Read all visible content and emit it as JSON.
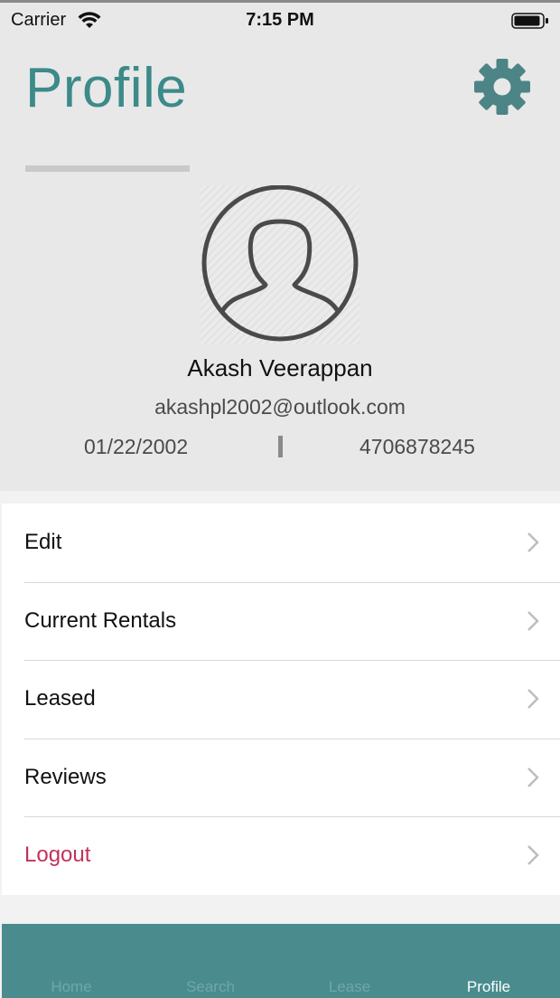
{
  "status_bar": {
    "carrier": "Carrier",
    "time": "7:15 PM"
  },
  "header": {
    "title": "Profile"
  },
  "user": {
    "name": "Akash Veerappan",
    "email": "akashpl2002@outlook.com",
    "dob": "01/22/2002",
    "phone": "4706878245"
  },
  "menu": {
    "items": [
      {
        "label": "Edit"
      },
      {
        "label": "Current Rentals"
      },
      {
        "label": "Leased"
      },
      {
        "label": "Reviews"
      },
      {
        "label": "Logout"
      }
    ]
  },
  "tabs": [
    {
      "label": "Home"
    },
    {
      "label": "Search"
    },
    {
      "label": "Lease"
    },
    {
      "label": "Profile"
    }
  ],
  "colors": {
    "accent": "#3c8a8a",
    "tab_bar": "#4a8c8e",
    "logout": "#c2325a",
    "header_bg": "#e8e8e8"
  },
  "icons": {
    "settings": "gear-icon",
    "avatar": "person-silhouette-icon",
    "row_disclosure": "chevron-right-icon"
  },
  "active_tab": "Profile"
}
